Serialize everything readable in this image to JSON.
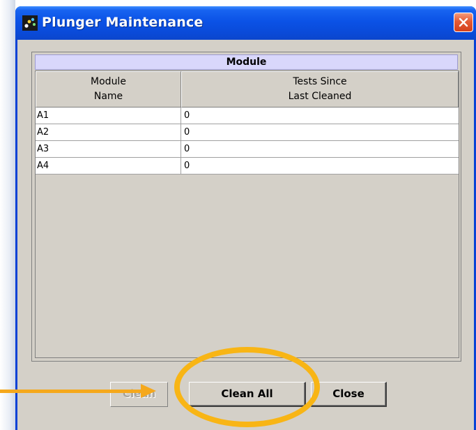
{
  "window": {
    "title": "Plunger Maintenance"
  },
  "panel": {
    "header": "Module",
    "columns": [
      "Module\nName",
      "Tests Since\nLast Cleaned"
    ],
    "rows": [
      {
        "name": "A1",
        "tests": "0"
      },
      {
        "name": "A2",
        "tests": "0"
      },
      {
        "name": "A3",
        "tests": "0"
      },
      {
        "name": "A4",
        "tests": "0"
      }
    ]
  },
  "buttons": {
    "clean": "Clean",
    "clean_all": "Clean All",
    "close": "Close"
  },
  "icons": {
    "app": "app-dots-icon",
    "close": "close-icon"
  },
  "colors": {
    "title_bar": "#0b52e6",
    "close_button": "#e45a35",
    "module_header": "#d9d7fb",
    "annotation": "#f8b515"
  }
}
